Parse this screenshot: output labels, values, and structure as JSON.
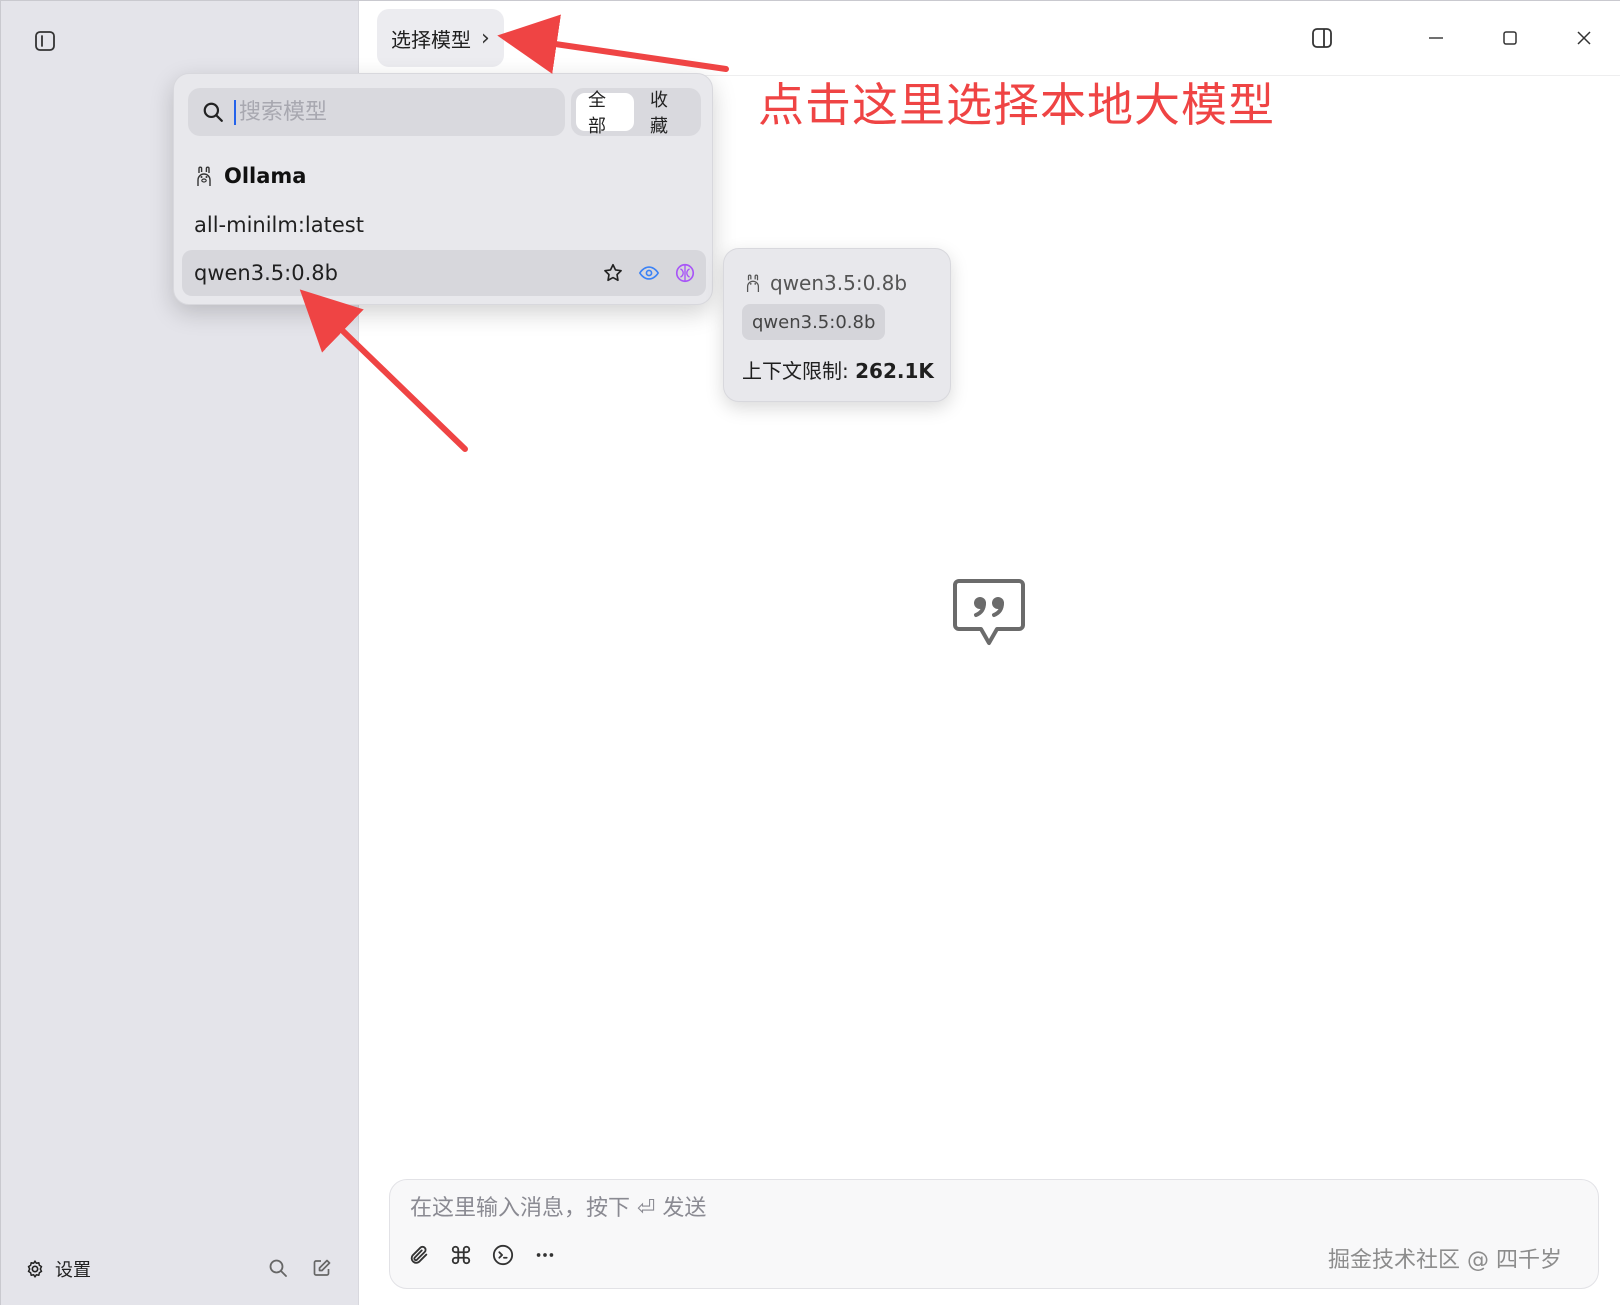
{
  "header": {
    "model_selector_label": "选择模型",
    "model_selector_chevron": "›"
  },
  "annotation": {
    "text": "点击这里选择本地大模型",
    "color": "#ef4444"
  },
  "model_popup": {
    "search_placeholder": "搜索模型",
    "filter_tabs": [
      {
        "label": "全部",
        "active": true
      },
      {
        "label": "收藏",
        "active": false
      }
    ],
    "group": {
      "name": "Ollama",
      "icon": "ollama-llama-icon"
    },
    "models": [
      {
        "name": "all-minilm:latest"
      },
      {
        "name": "qwen3.5:0.8b",
        "hovered": true,
        "icons": [
          "star-icon",
          "eye-icon",
          "brain-icon"
        ]
      }
    ]
  },
  "model_tooltip": {
    "title": "qwen3.5:0.8b",
    "tag": "qwen3.5:0.8b",
    "context_label": "上下文限制: ",
    "context_value": "262.1K"
  },
  "composer": {
    "placeholder": "在这里输入消息，按下 ⏎ 发送",
    "tools": [
      "paperclip-icon",
      "command-icon",
      "terminal-icon",
      "more-icon"
    ]
  },
  "sidebar": {
    "settings_label": "设置"
  },
  "watermark": "掘金技术社区 @ 四千岁",
  "colors": {
    "sidebar_bg": "#e4e4ea",
    "accent_eye": "#3b82f6",
    "accent_brain": "#a855f7"
  }
}
